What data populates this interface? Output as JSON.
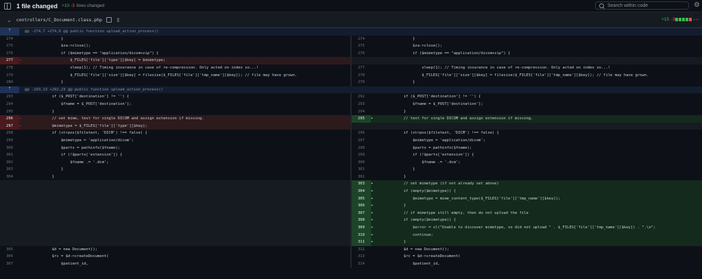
{
  "topbar": {
    "title": "1 file changed",
    "additions": "+10",
    "deletions": "-3",
    "lines_label": "lines changed",
    "search_placeholder": "Search within code"
  },
  "file": {
    "path": "controllers/C_Document.class.php",
    "additions": "+15",
    "deletions": "-3",
    "stat_blocks": [
      "#3fb950",
      "#3fb950",
      "#3fb950",
      "#3fb950",
      "#f85149"
    ]
  },
  "colors": {
    "add": "#3fb950",
    "del": "#f85149",
    "accent": "#1f6feb"
  },
  "rows": [
    {
      "kind": "hunk",
      "text": "@@ -274,7 +274,6 @@ public function upload_action_process()"
    },
    {
      "kind": "ctx",
      "l": {
        "n": "274",
        "s": "",
        "c": "                }"
      },
      "r": {
        "n": "274",
        "s": "",
        "c": "                }"
      }
    },
    {
      "kind": "ctx",
      "l": {
        "n": "275",
        "s": "",
        "c": "                $za->close();"
      },
      "r": {
        "n": "275",
        "s": "",
        "c": "                $za->close();"
      }
    },
    {
      "kind": "ctx",
      "l": {
        "n": "276",
        "s": "",
        "c": "                if ($mimetype == \"application/dicom+zip\") {"
      },
      "r": {
        "n": "276",
        "s": "",
        "c": "                if ($mimetype == \"application/dicom+zip\") {"
      }
    },
    {
      "kind": "delonly",
      "l": {
        "n": "277",
        "s": "-",
        "c": "                    $_FILES['file']['type'][$key] = $mimetype;"
      },
      "r": {
        "n": "",
        "s": "",
        "c": ""
      }
    },
    {
      "kind": "ctx",
      "l": {
        "n": "278",
        "s": "",
        "c": "                    sleep(1); // Timing insurance in case of re-compression. Only acted on index so...!"
      },
      "r": {
        "n": "277",
        "s": "",
        "c": "                    sleep(1); // Timing insurance in case of re-compression. Only acted on index so...!"
      }
    },
    {
      "kind": "ctx",
      "l": {
        "n": "279",
        "s": "",
        "c": "                    $_FILES['file']['size'][$key] = filesize($_FILES['file']['tmp_name'][$key]); // file may have grown."
      },
      "r": {
        "n": "278",
        "s": "",
        "c": "                    $_FILES['file']['size'][$key] = filesize($_FILES['file']['tmp_name'][$key]); // file may have grown."
      }
    },
    {
      "kind": "ctx",
      "l": {
        "n": "280",
        "s": "",
        "c": "                }"
      },
      "r": {
        "n": "279",
        "s": "",
        "c": "                }"
      }
    },
    {
      "kind": "hunk",
      "text": "@@ -293,13 +292,23 @@ public function upload_action_process()"
    },
    {
      "kind": "ctx",
      "l": {
        "n": "293",
        "s": "",
        "c": "            if ($_POST['destination'] != '') {"
      },
      "r": {
        "n": "292",
        "s": "",
        "c": "            if ($_POST['destination'] != '') {"
      }
    },
    {
      "kind": "ctx",
      "l": {
        "n": "294",
        "s": "",
        "c": "                $fname = $_POST['destination'];"
      },
      "r": {
        "n": "293",
        "s": "",
        "c": "                $fname = $_POST['destination'];"
      }
    },
    {
      "kind": "ctx",
      "l": {
        "n": "295",
        "s": "",
        "c": "            }"
      },
      "r": {
        "n": "294",
        "s": "",
        "c": "            }"
      }
    },
    {
      "kind": "change",
      "l": {
        "n": "296",
        "s": "-",
        "c": "            // set mime, test for single DICOM and assign extension if missing."
      },
      "r": {
        "n": "295",
        "s": "+",
        "c": "            // test for single DICOM and assign extension if missing."
      }
    },
    {
      "kind": "delonly",
      "l": {
        "n": "297",
        "s": "-",
        "c": "            $mimetype = $_FILES['file']['type'][$key];"
      },
      "r": {
        "n": "",
        "s": "",
        "c": ""
      }
    },
    {
      "kind": "ctx",
      "l": {
        "n": "298",
        "s": "",
        "c": "            if (strpos($filetext, 'DICM') !== false) {"
      },
      "r": {
        "n": "296",
        "s": "",
        "c": "            if (strpos($filetext, 'DICM') !== false) {"
      }
    },
    {
      "kind": "ctx",
      "l": {
        "n": "299",
        "s": "",
        "c": "                $mimetype = 'application/dicom';"
      },
      "r": {
        "n": "297",
        "s": "",
        "c": "                $mimetype = 'application/dicom';"
      }
    },
    {
      "kind": "ctx",
      "l": {
        "n": "300",
        "s": "",
        "c": "                $parts = pathinfo($fname);"
      },
      "r": {
        "n": "298",
        "s": "",
        "c": "                $parts = pathinfo($fname);"
      }
    },
    {
      "kind": "ctx",
      "l": {
        "n": "301",
        "s": "",
        "c": "                if (!$parts['extension']) {"
      },
      "r": {
        "n": "299",
        "s": "",
        "c": "                if (!$parts['extension']) {"
      }
    },
    {
      "kind": "ctx",
      "l": {
        "n": "302",
        "s": "",
        "c": "                    $fname .= '.dcm';"
      },
      "r": {
        "n": "300",
        "s": "",
        "c": "                    $fname .= '.dcm';"
      }
    },
    {
      "kind": "ctx",
      "l": {
        "n": "303",
        "s": "",
        "c": "                }"
      },
      "r": {
        "n": "301",
        "s": "",
        "c": "                }"
      }
    },
    {
      "kind": "ctx",
      "l": {
        "n": "304",
        "s": "",
        "c": "            }"
      },
      "r": {
        "n": "302",
        "s": "",
        "c": "            }"
      }
    },
    {
      "kind": "addonly",
      "l": {
        "n": "",
        "s": "",
        "c": ""
      },
      "r": {
        "n": "303",
        "s": "+",
        "c": "            // set mimetype (if not already set above)"
      }
    },
    {
      "kind": "addonly",
      "l": {
        "n": "",
        "s": "",
        "c": ""
      },
      "r": {
        "n": "304",
        "s": "+",
        "c": "            if (empty($mimetype)) {"
      }
    },
    {
      "kind": "addonly",
      "l": {
        "n": "",
        "s": "",
        "c": ""
      },
      "r": {
        "n": "305",
        "s": "+",
        "c": "                $mimetype = mime_content_type($_FILES['file']['tmp_name'][$key]);"
      }
    },
    {
      "kind": "addonly",
      "l": {
        "n": "",
        "s": "",
        "c": ""
      },
      "r": {
        "n": "306",
        "s": "+",
        "c": "            }"
      }
    },
    {
      "kind": "addonly",
      "l": {
        "n": "",
        "s": "",
        "c": ""
      },
      "r": {
        "n": "307",
        "s": "+",
        "c": "            // if mimetype still empty, then do not upload the file"
      }
    },
    {
      "kind": "addonly",
      "l": {
        "n": "",
        "s": "",
        "c": ""
      },
      "r": {
        "n": "308",
        "s": "+",
        "c": "            if (empty($mimetype)) {"
      }
    },
    {
      "kind": "addonly",
      "l": {
        "n": "",
        "s": "",
        "c": ""
      },
      "r": {
        "n": "309",
        "s": "+",
        "c": "                $error = xl(\"Unable to discover mimetype, so did not upload \" . $_FILES['file']['tmp_name'][$key]) . \".\\n\";"
      }
    },
    {
      "kind": "addonly",
      "l": {
        "n": "",
        "s": "",
        "c": ""
      },
      "r": {
        "n": "310",
        "s": "+",
        "c": "                continue;"
      }
    },
    {
      "kind": "addonly",
      "l": {
        "n": "",
        "s": "",
        "c": ""
      },
      "r": {
        "n": "311",
        "s": "+",
        "c": "            }"
      }
    },
    {
      "kind": "ctx",
      "l": {
        "n": "305",
        "s": "",
        "c": "            $d = new Document();"
      },
      "r": {
        "n": "312",
        "s": "",
        "c": "            $d = new Document();"
      }
    },
    {
      "kind": "ctx",
      "l": {
        "n": "306",
        "s": "",
        "c": "            $rc = $d->createDocument("
      },
      "r": {
        "n": "313",
        "s": "",
        "c": "            $rc = $d->createDocument("
      }
    },
    {
      "kind": "ctx",
      "l": {
        "n": "307",
        "s": "",
        "c": "                $patient_id,"
      },
      "r": {
        "n": "314",
        "s": "",
        "c": "                $patient_id,"
      }
    }
  ]
}
